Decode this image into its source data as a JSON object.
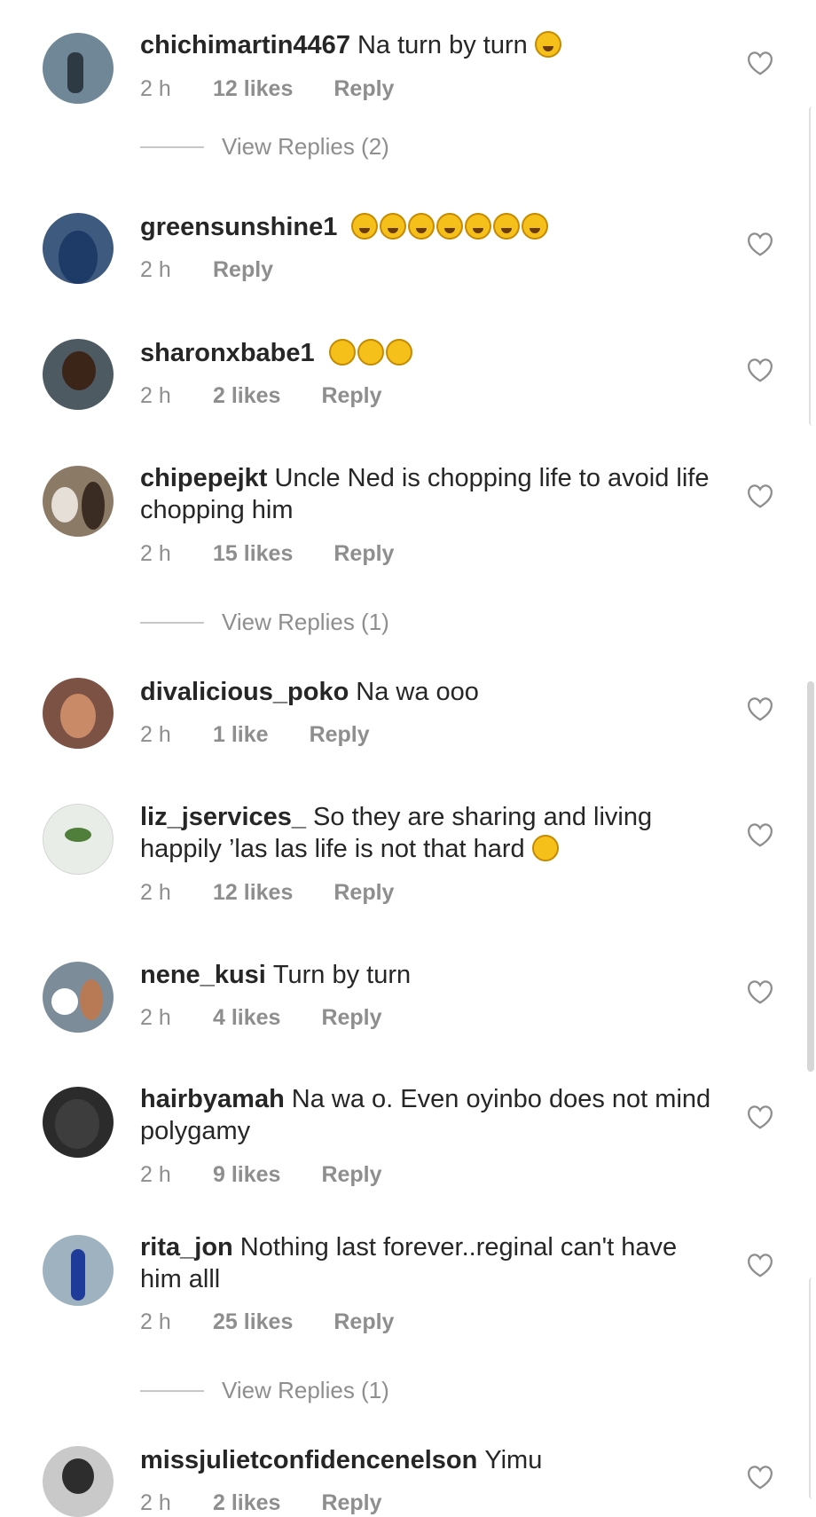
{
  "comments": [
    {
      "user": "chichimartin4467",
      "text": "Na turn by turn",
      "emoji": "grinning-face-emoji",
      "time": "2 h",
      "likes": "12 likes",
      "reply": "Reply",
      "view_replies": "View Replies (2)",
      "avatar_color": "#6f8796"
    },
    {
      "user": "greensunshine1",
      "text": "",
      "emoji": "7x laughing-face-emoji",
      "time": "2 h",
      "likes": "",
      "reply": "Reply",
      "view_replies": "",
      "avatar_color": "#3f5a7f"
    },
    {
      "user": "sharonxbabe1",
      "text": "",
      "emoji": "3x crying-face-emoji",
      "time": "2 h",
      "likes": "2 likes",
      "reply": "Reply",
      "view_replies": "",
      "avatar_color": "#4d5a62"
    },
    {
      "user": "chipepejkt",
      "text": "Uncle Ned is chopping life to avoid life chopping him",
      "emoji": "",
      "time": "2 h",
      "likes": "15 likes",
      "reply": "Reply",
      "view_replies": "View Replies (1)",
      "avatar_color": "#8a7a66"
    },
    {
      "user": "divalicious_poko",
      "text": "Na wa ooo",
      "emoji": "",
      "time": "2 h",
      "likes": "1 like",
      "reply": "Reply",
      "view_replies": "",
      "avatar_color": "#7c5244"
    },
    {
      "user": "liz_jservices_",
      "text": "So they are sharing and living happily ’las las life is not that hard",
      "emoji": "weary-face-emoji",
      "time": "2 h",
      "likes": "12 likes",
      "reply": "Reply",
      "view_replies": "",
      "avatar_color": "#e9ede7"
    },
    {
      "user": "nene_kusi",
      "text": "Turn by turn",
      "emoji": "",
      "time": "2 h",
      "likes": "4 likes",
      "reply": "Reply",
      "view_replies": "",
      "avatar_color": "#7c8c99"
    },
    {
      "user": "hairbyamah",
      "text": "Na wa o. Even oyinbo does not mind polygamy",
      "emoji": "",
      "time": "2 h",
      "likes": "9 likes",
      "reply": "Reply",
      "view_replies": "",
      "avatar_color": "#2b2b2b"
    },
    {
      "user": "rita_jon",
      "text": "Nothing last forever..reginal can't have him alll",
      "emoji": "",
      "time": "2 h",
      "likes": "25 likes",
      "reply": "Reply",
      "view_replies": "View Replies (1)",
      "avatar_color": "#9fb2bf"
    },
    {
      "user": "missjulietconfidencenelson",
      "text": "Yimu",
      "emoji": "",
      "time": "2 h",
      "likes": "2 likes",
      "reply": "Reply",
      "view_replies": "",
      "avatar_color": "#c9c9c9"
    }
  ],
  "colors": {
    "meta": "#8e8e8e",
    "text": "#262626",
    "heart": "#8e8e8e"
  }
}
